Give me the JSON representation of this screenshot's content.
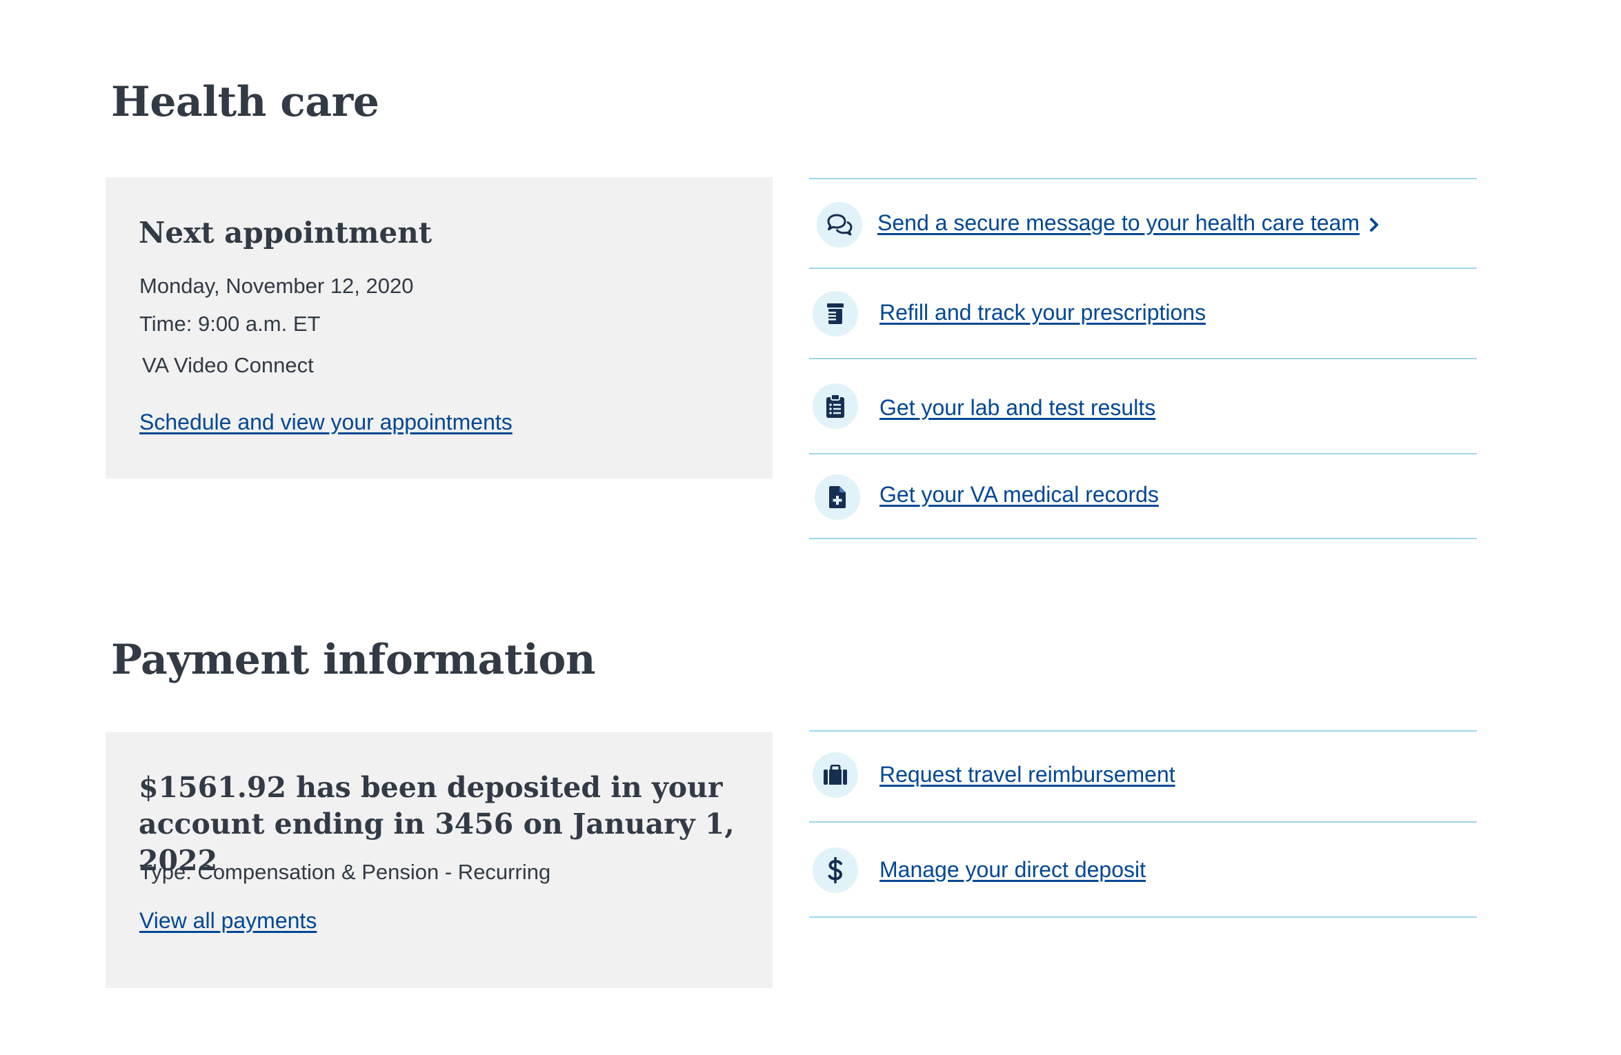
{
  "health_care": {
    "title": "Health care",
    "appointment": {
      "heading": "Next appointment",
      "date": "Monday, November 12, 2020",
      "time": "Time: 9:00 a.m. ET",
      "location": "VA Video Connect",
      "link": "Schedule and view your appointments"
    },
    "links": [
      {
        "label": "Send a secure message to your health care team",
        "icon": "messages-icon"
      },
      {
        "label": "Refill and track your prescriptions",
        "icon": "prescription-bottle-icon"
      },
      {
        "label": "Get your lab and test results",
        "icon": "clipboard-list-icon"
      },
      {
        "label": "Get your VA medical records",
        "icon": "medical-file-icon"
      }
    ]
  },
  "payment": {
    "title": "Payment information",
    "deposit": {
      "heading": "$1561.92 has been deposited in your account ending in 3456 on January 1, 2022",
      "type": "Type: Compensation & Pension - Recurring",
      "link": "View all payments"
    },
    "links": [
      {
        "label": "Request travel reimbursement",
        "icon": "suitcase-icon"
      },
      {
        "label": "Manage your direct deposit",
        "icon": "dollar-sign-icon"
      }
    ]
  },
  "colors": {
    "link": "#004795",
    "text": "#323a45",
    "card_background": "#f1f1f1",
    "divider": "#9ed6ee",
    "icon_background": "#e1f3f8",
    "icon": "#162e51"
  }
}
